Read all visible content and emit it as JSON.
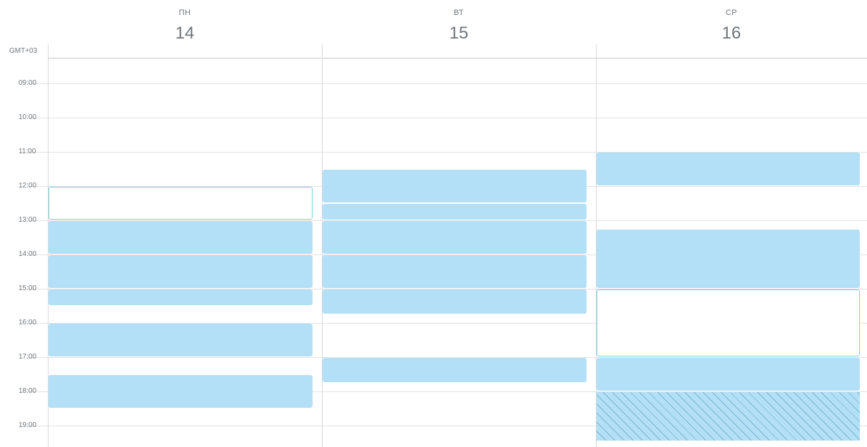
{
  "timezone_label": "GMT+03",
  "days": [
    {
      "weekday": "ПН",
      "date": "14"
    },
    {
      "weekday": "ВТ",
      "date": "15"
    },
    {
      "weekday": "СР",
      "date": "16"
    }
  ],
  "hours": [
    "09:00",
    "10:00",
    "11:00",
    "12:00",
    "13:00",
    "14:00",
    "15:00",
    "16:00",
    "17:00",
    "18:00",
    "19:00"
  ],
  "day_start_hour": 8.3,
  "colors": {
    "busy": "#b3e0f6",
    "outline_border": "#7ccfd9",
    "text": "#70757a",
    "grid": "#e2e2e2"
  },
  "events": [
    {
      "day": 0,
      "start": "12:00",
      "end": "13:00",
      "style": "outline"
    },
    {
      "day": 0,
      "start": "13:00",
      "end": "14:00",
      "style": "busy"
    },
    {
      "day": 0,
      "start": "14:00",
      "end": "15:00",
      "style": "busy"
    },
    {
      "day": 0,
      "start": "15:00",
      "end": "15:30",
      "style": "busy"
    },
    {
      "day": 0,
      "start": "16:00",
      "end": "17:00",
      "style": "busy"
    },
    {
      "day": 0,
      "start": "17:30",
      "end": "18:30",
      "style": "busy"
    },
    {
      "day": 1,
      "start": "11:30",
      "end": "12:30",
      "style": "busy"
    },
    {
      "day": 1,
      "start": "12:30",
      "end": "13:00",
      "style": "busy"
    },
    {
      "day": 1,
      "start": "13:00",
      "end": "14:00",
      "style": "busy"
    },
    {
      "day": 1,
      "start": "14:00",
      "end": "15:00",
      "style": "busy"
    },
    {
      "day": 1,
      "start": "15:00",
      "end": "15:45",
      "style": "busy"
    },
    {
      "day": 1,
      "start": "17:00",
      "end": "17:45",
      "style": "busy"
    },
    {
      "day": 2,
      "start": "11:00",
      "end": "12:00",
      "style": "busy"
    },
    {
      "day": 2,
      "start": "13:15",
      "end": "15:00",
      "style": "busy"
    },
    {
      "day": 2,
      "start": "15:00",
      "end": "17:00",
      "style": "outline"
    },
    {
      "day": 2,
      "start": "17:00",
      "end": "18:00",
      "style": "busy"
    },
    {
      "day": 2,
      "start": "18:00",
      "end": "19:30",
      "style": "hatched"
    }
  ]
}
